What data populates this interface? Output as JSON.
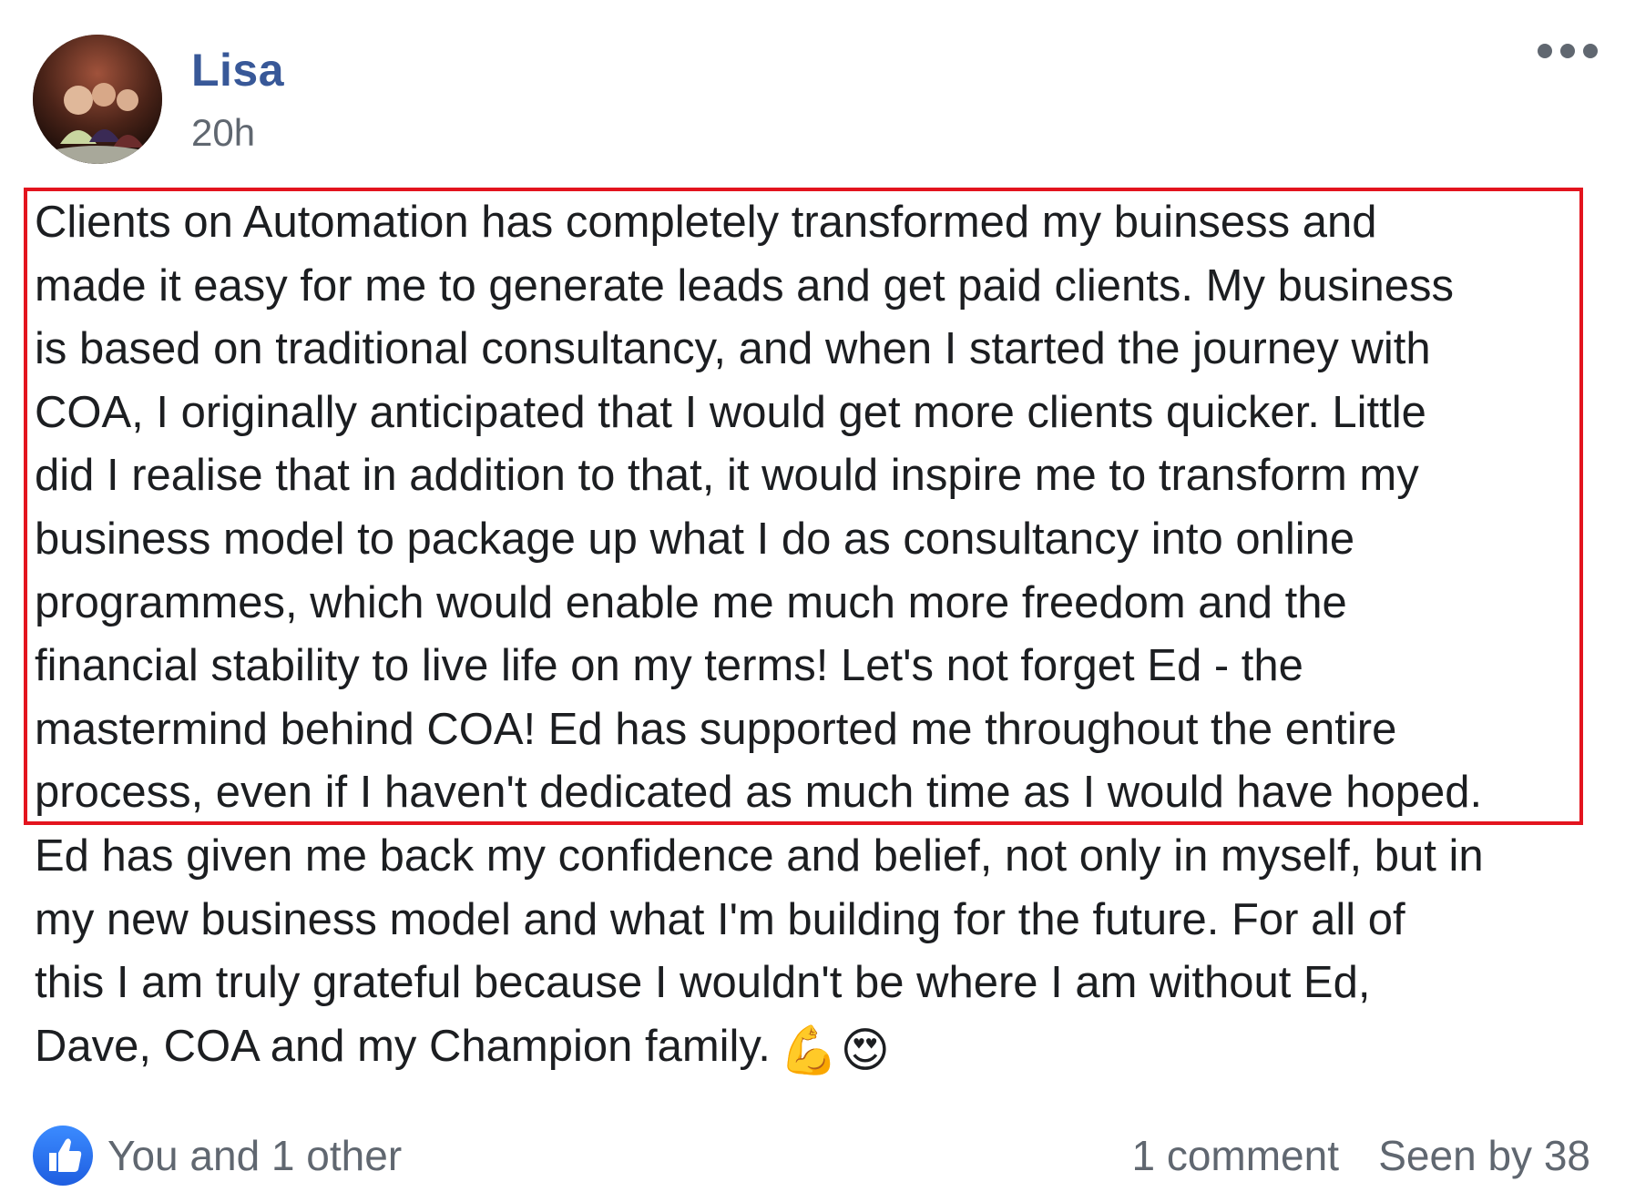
{
  "post": {
    "author": "Lisa",
    "timestamp": "20h",
    "more_icon": "ellipsis-icon",
    "body_lines": [
      "Clients on Automation has completely transformed my buinsess and",
      "made it easy for me to generate leads and get paid clients. My business",
      "is based on traditional consultancy, and when I started the journey with",
      "COA, I originally anticipated that I would get more clients quicker. Little",
      "did I realise that in addition to that, it would inspire me to transform my",
      "business model to package up what I do as consultancy into online",
      "programmes, which would enable me much more freedom and the",
      "financial stability to live life on my terms! Let's not forget Ed - the",
      "mastermind behind COA! Ed has supported me throughout the entire",
      "process, even if I haven't dedicated as much time as I would have hoped.",
      "Ed has given me back my confidence and belief, not only in myself, but in",
      "my new business model and what I'm building for the future. For all of",
      "this I am truly grateful because I wouldn't be where I am without Ed,",
      "Dave, COA and my Champion family."
    ],
    "emojis": [
      "💪",
      "😍"
    ],
    "highlight_color": "#e3141e"
  },
  "footer": {
    "like_icon": "like-thumb-icon",
    "reactions_text": "You and 1 other",
    "comments_text": "1 comment",
    "seen_by_text": "Seen by 38"
  },
  "colors": {
    "author_link": "#385898",
    "secondary_text": "#606770",
    "body_text": "#1c1e21",
    "like_blue": "#1f5ee0"
  }
}
